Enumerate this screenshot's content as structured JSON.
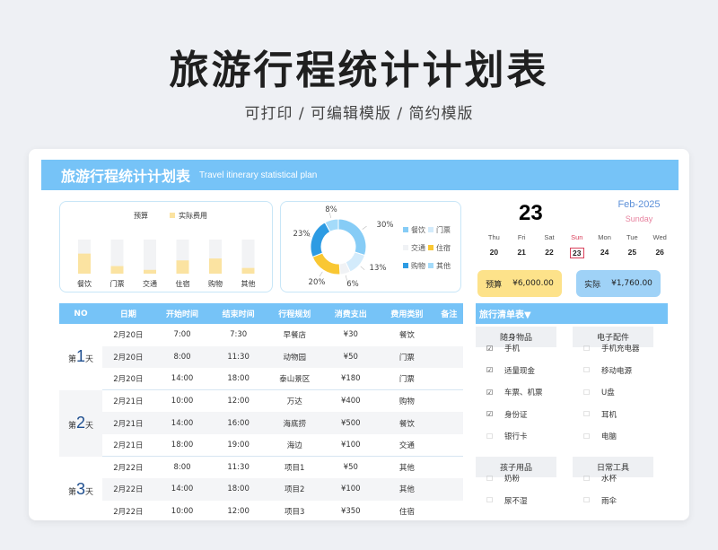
{
  "page": {
    "title": "旅游行程统计计划表",
    "subtitle": "可打印 / 可编辑模版 / 简约模版"
  },
  "banner": {
    "title": "旅游行程统计计划表",
    "subtitle_en": "Travel itinerary statistical plan"
  },
  "bar_chart": {
    "legend": [
      "预算",
      "实际费用"
    ],
    "chart_data": {
      "type": "bar",
      "categories": [
        "餐饮",
        "门票",
        "交通",
        "住宿",
        "购物",
        "其他"
      ],
      "series": [
        {
          "name": "预算",
          "values": [
            900,
            900,
            900,
            900,
            900,
            900
          ]
        },
        {
          "name": "实际费用",
          "values": [
            530,
            200,
            100,
            350,
            400,
            150
          ]
        }
      ],
      "colors": {
        "plan": "#f2f3f5",
        "actual": "#fbe3a1"
      }
    }
  },
  "donut_chart": {
    "chart_data": {
      "type": "pie",
      "categories": [
        "餐饮",
        "门票",
        "交通",
        "住宿",
        "购物",
        "其他"
      ],
      "values": [
        30,
        13,
        6,
        20,
        23,
        8
      ],
      "labels": [
        "30%",
        "13%",
        "6%",
        "20%",
        "23%",
        "8%"
      ],
      "colors": [
        "#86ccf6",
        "#d3ebfb",
        "#f0f2f5",
        "#f9c733",
        "#2d9be3",
        "#a4dbfa"
      ]
    }
  },
  "calendar": {
    "day": "23",
    "month": "Feb-2025",
    "weekday": "Sunday",
    "week": [
      {
        "w": "Thu",
        "d": "20"
      },
      {
        "w": "Fri",
        "d": "21"
      },
      {
        "w": "Sat",
        "d": "22"
      },
      {
        "w": "Sun",
        "d": "23"
      },
      {
        "w": "Mon",
        "d": "24"
      },
      {
        "w": "Tue",
        "d": "25"
      },
      {
        "w": "Wed",
        "d": "26"
      }
    ],
    "today_index": 3
  },
  "summary": {
    "budget_label": "预算",
    "budget_value": "¥6,000.00",
    "actual_label": "实际",
    "actual_value": "¥1,760.00"
  },
  "table": {
    "headers": [
      "NO",
      "日期",
      "开始时间",
      "结束时间",
      "行程规划",
      "消费支出",
      "费用类别",
      "备注"
    ],
    "groups": [
      {
        "prefix": "第",
        "num": "1",
        "suffix": "天",
        "rows": [
          [
            "2月20日",
            "7:00",
            "7:30",
            "早餐店",
            "¥30",
            "餐饮",
            ""
          ],
          [
            "2月20日",
            "8:00",
            "11:30",
            "动物园",
            "¥50",
            "门票",
            ""
          ],
          [
            "2月20日",
            "14:00",
            "18:00",
            "泰山景区",
            "¥180",
            "门票",
            ""
          ]
        ]
      },
      {
        "prefix": "第",
        "num": "2",
        "suffix": "天",
        "rows": [
          [
            "2月21日",
            "10:00",
            "12:00",
            "万达",
            "¥400",
            "购物",
            ""
          ],
          [
            "2月21日",
            "14:00",
            "16:00",
            "海底捞",
            "¥500",
            "餐饮",
            ""
          ],
          [
            "2月21日",
            "18:00",
            "19:00",
            "海边",
            "¥100",
            "交通",
            ""
          ]
        ]
      },
      {
        "prefix": "第",
        "num": "3",
        "suffix": "天",
        "rows": [
          [
            "2月22日",
            "8:00",
            "11:30",
            "项目1",
            "¥50",
            "其他",
            ""
          ],
          [
            "2月22日",
            "14:00",
            "18:00",
            "项目2",
            "¥100",
            "其他",
            ""
          ],
          [
            "2月22日",
            "10:00",
            "12:00",
            "项目3",
            "¥350",
            "住宿",
            ""
          ]
        ]
      }
    ]
  },
  "checklist": {
    "title": "旅行清单表▼",
    "categories": [
      {
        "name": "随身物品",
        "items": [
          {
            "label": "手机",
            "checked": true
          },
          {
            "label": "适量现金",
            "checked": true
          },
          {
            "label": "车票、机票",
            "checked": true
          },
          {
            "label": "身份证",
            "checked": true
          },
          {
            "label": "银行卡",
            "checked": false
          }
        ]
      },
      {
        "name": "电子配件",
        "items": [
          {
            "label": "手机充电器",
            "checked": false
          },
          {
            "label": "移动电源",
            "checked": false
          },
          {
            "label": "U盘",
            "checked": false
          },
          {
            "label": "耳机",
            "checked": false
          },
          {
            "label": "电脑",
            "checked": false
          }
        ]
      },
      {
        "name": "孩子用品",
        "items": [
          {
            "label": "奶粉",
            "checked": false
          },
          {
            "label": "尿不湿",
            "checked": false
          }
        ]
      },
      {
        "name": "日常工具",
        "items": [
          {
            "label": "水杯",
            "checked": false
          },
          {
            "label": "雨伞",
            "checked": false
          }
        ]
      }
    ],
    "check_on": "☑",
    "check_off": "☐"
  }
}
